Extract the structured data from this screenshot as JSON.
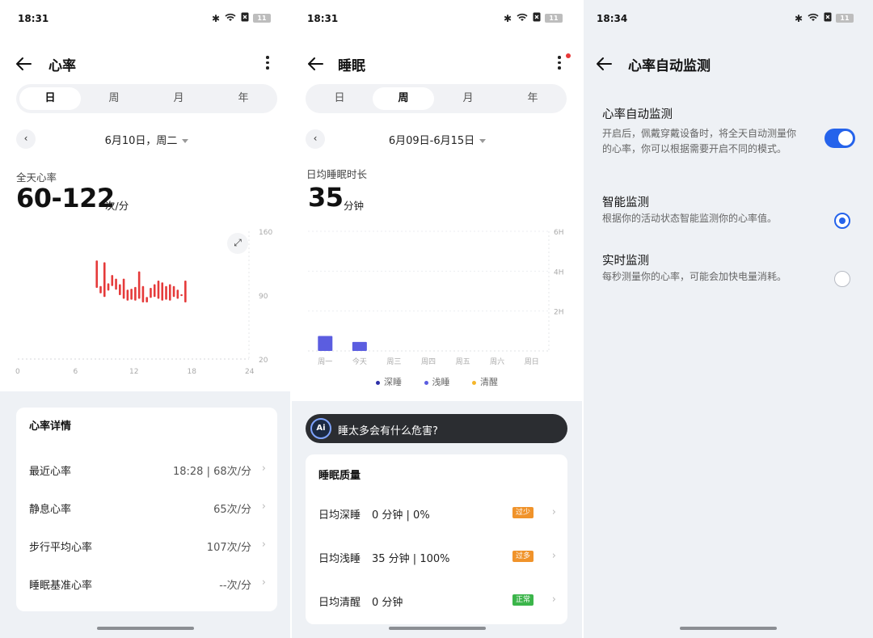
{
  "status": {
    "time1": "18:31",
    "time2": "18:31",
    "time3": "18:34",
    "battery": "11"
  },
  "heart": {
    "title": "心率",
    "tabs": [
      "日",
      "周",
      "月",
      "年"
    ],
    "date": "6月10日，周二",
    "all_day_label": "全天心率",
    "range_value": "60-122",
    "range_unit": "次/分",
    "details_title": "心率详情",
    "details": [
      {
        "label": "最近心率",
        "value": "18:28 | 68次/分"
      },
      {
        "label": "静息心率",
        "value": "65次/分"
      },
      {
        "label": "步行平均心率",
        "value": "107次/分"
      },
      {
        "label": "睡眠基准心率",
        "value": "--次/分"
      }
    ],
    "chart_data": {
      "type": "bar",
      "x_ticks": [
        "0",
        "6",
        "12",
        "18",
        "24"
      ],
      "y_ticks": [
        "160",
        "90",
        "20"
      ],
      "ylim": [
        20,
        160
      ],
      "xlim": [
        0,
        24
      ],
      "color": "#e53a3a",
      "bars": [
        {
          "x": 8.2,
          "low": 98,
          "high": 128
        },
        {
          "x": 8.6,
          "low": 92,
          "high": 100
        },
        {
          "x": 9.0,
          "low": 88,
          "high": 126
        },
        {
          "x": 9.4,
          "low": 95,
          "high": 103
        },
        {
          "x": 9.8,
          "low": 100,
          "high": 112
        },
        {
          "x": 10.2,
          "low": 96,
          "high": 108
        },
        {
          "x": 10.6,
          "low": 90,
          "high": 102
        },
        {
          "x": 11.0,
          "low": 86,
          "high": 108
        },
        {
          "x": 11.4,
          "low": 84,
          "high": 96
        },
        {
          "x": 11.8,
          "low": 85,
          "high": 97
        },
        {
          "x": 12.2,
          "low": 84,
          "high": 99
        },
        {
          "x": 12.6,
          "low": 86,
          "high": 116
        },
        {
          "x": 13.0,
          "low": 82,
          "high": 100
        },
        {
          "x": 13.4,
          "low": 82,
          "high": 88
        },
        {
          "x": 13.8,
          "low": 87,
          "high": 98
        },
        {
          "x": 14.2,
          "low": 88,
          "high": 102
        },
        {
          "x": 14.6,
          "low": 86,
          "high": 106
        },
        {
          "x": 15.0,
          "low": 84,
          "high": 104
        },
        {
          "x": 15.4,
          "low": 85,
          "high": 100
        },
        {
          "x": 15.8,
          "low": 84,
          "high": 102
        },
        {
          "x": 16.2,
          "low": 88,
          "high": 100
        },
        {
          "x": 16.6,
          "low": 86,
          "high": 96
        },
        {
          "x": 17.0,
          "low": 89,
          "high": 91
        },
        {
          "x": 17.4,
          "low": 82,
          "high": 106
        }
      ]
    }
  },
  "sleep": {
    "title": "睡眠",
    "tabs": [
      "日",
      "周",
      "月",
      "年"
    ],
    "date": "6月09日-6月15日",
    "avg_label": "日均睡眠时长",
    "avg_value": "35",
    "avg_unit": "分钟",
    "legend": [
      {
        "name": "深睡",
        "color": "#2d2fa8"
      },
      {
        "name": "浅睡",
        "color": "#5b5de0"
      },
      {
        "name": "清醒",
        "color": "#f5b62b"
      }
    ],
    "ask": "睡太多会有什么危害?",
    "ai_badge": "Ai",
    "quality_title": "睡眠质量",
    "quality": [
      {
        "label": "日均深睡",
        "value": "0 分钟 | 0%",
        "tag": "过少",
        "tag_color": "#f0932b"
      },
      {
        "label": "日均浅睡",
        "value": "35 分钟 | 100%",
        "tag": "过多",
        "tag_color": "#f0932b"
      },
      {
        "label": "日均清醒",
        "value": "0 分钟",
        "tag": "正常",
        "tag_color": "#3bb54a"
      }
    ],
    "chart_data": {
      "type": "bar",
      "categories": [
        "周一",
        "今天",
        "周三",
        "周四",
        "周五",
        "周六",
        "周日"
      ],
      "y_ticks": [
        "6H",
        "4H",
        "2H"
      ],
      "ylim": [
        0,
        6
      ],
      "series": [
        {
          "name": "浅睡",
          "values": [
            0.75,
            0.45,
            0,
            0,
            0,
            0,
            0
          ]
        }
      ],
      "color": "#5b5de0"
    }
  },
  "auto": {
    "title": "心率自动监测",
    "main_title": "心率自动监测",
    "main_desc": "开启后，佩戴穿戴设备时，将全天自动测量你的心率，你可以根据需要开启不同的模式。",
    "options": [
      {
        "title": "智能监测",
        "desc": "根据你的活动状态智能监测你的心率值。",
        "selected": true
      },
      {
        "title": "实时监测",
        "desc": "每秒测量你的心率，可能会加快电量消耗。",
        "selected": false
      }
    ]
  },
  "colors": {
    "accent": "#2563eb",
    "heart_bar": "#e53a3a",
    "sleep_bar": "#5b5de0"
  }
}
